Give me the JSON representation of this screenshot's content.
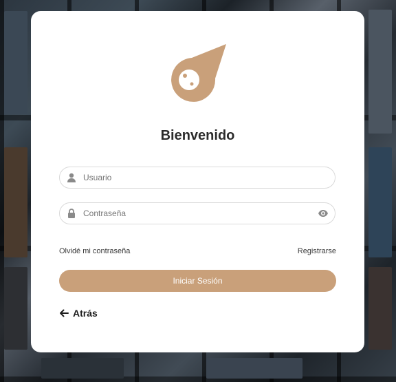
{
  "colors": {
    "accent": "#c9a07a",
    "icon": "#8a8a8a",
    "text": "#2b2b2b"
  },
  "logo": {
    "icon": "comet-icon"
  },
  "title": "Bienvenido",
  "username": {
    "placeholder": "Usuario",
    "icon": "user-icon"
  },
  "password": {
    "placeholder": "Contraseña",
    "icon": "lock-icon",
    "toggle_icon": "eye-icon"
  },
  "links": {
    "forgot": "Olvidé mi contraseña",
    "register": "Registrarse"
  },
  "login_button": "Iniciar Sesión",
  "back": {
    "label": "Atrás",
    "icon": "arrow-left-icon"
  }
}
